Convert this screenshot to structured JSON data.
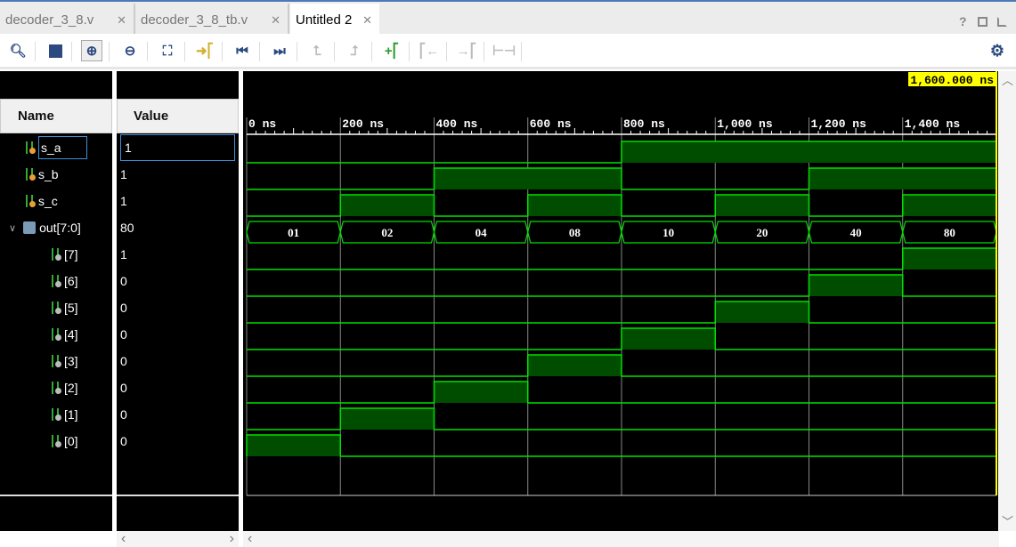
{
  "tabs": [
    {
      "label": "decoder_3_8.v",
      "active": false
    },
    {
      "label": "decoder_3_8_tb.v",
      "active": false
    },
    {
      "label": "Untitled 2",
      "active": true
    }
  ],
  "window_buttons": [
    "help-icon",
    "maximize-icon",
    "float-icon"
  ],
  "toolbar": [
    "search",
    "save",
    "zoom-in",
    "zoom-out",
    "zoom-fit",
    "go-to-cursor",
    "go-to-start",
    "go-to-end",
    "previous-transition",
    "next-transition",
    "add-marker",
    "previous-marker",
    "next-marker",
    "swap-cursors"
  ],
  "columns": {
    "name": "Name",
    "value": "Value"
  },
  "cursor": {
    "label": "1,600.000 ns",
    "time_ns": 1600,
    "color": "#ffff00"
  },
  "timeline": {
    "unit": "ns",
    "start": 0,
    "end": 1600,
    "ticks": [
      "0 ns",
      "200 ns",
      "400 ns",
      "600 ns",
      "800 ns",
      "1,000 ns",
      "1,200 ns",
      "1,400 ns"
    ],
    "tick_values": [
      0,
      200,
      400,
      600,
      800,
      1000,
      1200,
      1400
    ]
  },
  "colors": {
    "wave": "#00e000",
    "wave_fill": "#004d00",
    "grid": "#888888",
    "selection": "#3c8fd8"
  },
  "signals": [
    {
      "name": "s_a",
      "value": "1",
      "type": "bit",
      "indent": 1,
      "selected": true,
      "high": [
        [
          800,
          1600
        ]
      ]
    },
    {
      "name": "s_b",
      "value": "1",
      "type": "bit",
      "indent": 1,
      "high": [
        [
          400,
          800
        ],
        [
          1200,
          1600
        ]
      ]
    },
    {
      "name": "s_c",
      "value": "1",
      "type": "bit",
      "indent": 1,
      "high": [
        [
          200,
          400
        ],
        [
          600,
          800
        ],
        [
          1000,
          1200
        ],
        [
          1400,
          1600
        ]
      ]
    },
    {
      "name": "out[7:0]",
      "value": "80",
      "type": "bus",
      "indent": 0,
      "expanded": true,
      "segments": [
        {
          "from": 0,
          "to": 200,
          "v": "01"
        },
        {
          "from": 200,
          "to": 400,
          "v": "02"
        },
        {
          "from": 400,
          "to": 600,
          "v": "04"
        },
        {
          "from": 600,
          "to": 800,
          "v": "08"
        },
        {
          "from": 800,
          "to": 1000,
          "v": "10"
        },
        {
          "from": 1000,
          "to": 1200,
          "v": "20"
        },
        {
          "from": 1200,
          "to": 1400,
          "v": "40"
        },
        {
          "from": 1400,
          "to": 1600,
          "v": "80"
        }
      ]
    },
    {
      "name": "[7]",
      "value": "1",
      "type": "bit",
      "indent": 2,
      "high": [
        [
          1400,
          1600
        ]
      ]
    },
    {
      "name": "[6]",
      "value": "0",
      "type": "bit",
      "indent": 2,
      "high": [
        [
          1200,
          1400
        ]
      ]
    },
    {
      "name": "[5]",
      "value": "0",
      "type": "bit",
      "indent": 2,
      "high": [
        [
          1000,
          1200
        ]
      ]
    },
    {
      "name": "[4]",
      "value": "0",
      "type": "bit",
      "indent": 2,
      "high": [
        [
          800,
          1000
        ]
      ]
    },
    {
      "name": "[3]",
      "value": "0",
      "type": "bit",
      "indent": 2,
      "high": [
        [
          600,
          800
        ]
      ]
    },
    {
      "name": "[2]",
      "value": "0",
      "type": "bit",
      "indent": 2,
      "high": [
        [
          400,
          600
        ]
      ]
    },
    {
      "name": "[1]",
      "value": "0",
      "type": "bit",
      "indent": 2,
      "high": [
        [
          200,
          400
        ]
      ]
    },
    {
      "name": "[0]",
      "value": "0",
      "type": "bit",
      "indent": 2,
      "high": [
        [
          0,
          200
        ]
      ]
    }
  ]
}
